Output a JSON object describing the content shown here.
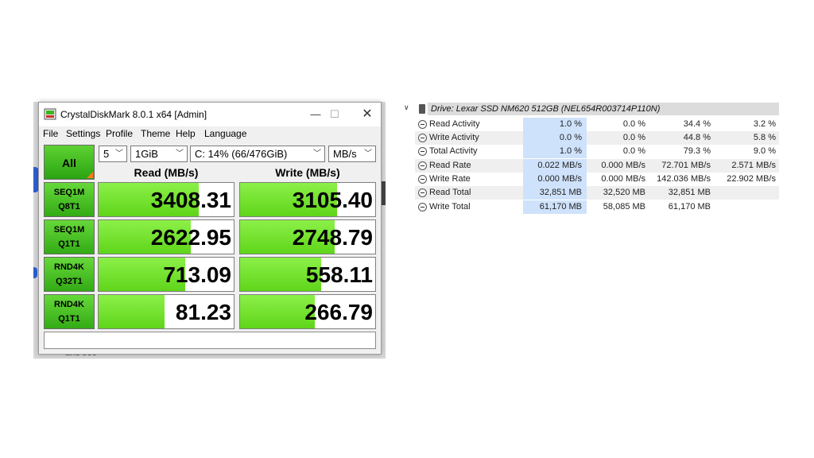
{
  "crystaldiskmark": {
    "title": "CrystalDiskMark 8.0.1 x64 [Admin]",
    "window_controls": {
      "minimize": "—",
      "maximize": "☐",
      "close": "✕"
    },
    "menu": [
      "File",
      "Settings",
      "Profile",
      "Theme",
      "Help",
      "Language"
    ],
    "all_button": "All",
    "test_count": "5",
    "test_size": "1GiB",
    "drive": "C: 14% (66/476GiB)",
    "unit": "MB/s",
    "read_header": "Read (MB/s)",
    "write_header": "Write (MB/s)",
    "tests": [
      {
        "line1": "SEQ1M",
        "line2": "Q8T1",
        "read": "3408.31",
        "write": "3105.40",
        "read_fill": 0.74,
        "write_fill": 0.72
      },
      {
        "line1": "SEQ1M",
        "line2": "Q1T1",
        "read": "2622.95",
        "write": "2748.79",
        "read_fill": 0.68,
        "write_fill": 0.7
      },
      {
        "line1": "RND4K",
        "line2": "Q32T1",
        "read": "713.09",
        "write": "558.11",
        "read_fill": 0.64,
        "write_fill": 0.6
      },
      {
        "line1": "RND4K",
        "line2": "Q1T1",
        "read": "81.23",
        "write": "266.79",
        "read_fill": 0.49,
        "write_fill": 0.55
      }
    ],
    "comment": "",
    "colors": {
      "accent_green": "#5fd51a",
      "corner_orange": "#ff7a1a"
    }
  },
  "background": {
    "fragment_text": "and 500"
  },
  "drive_panel": {
    "label": "Drive: Lexar SSD NM620 512GB (NEL654R003714P110N)",
    "rows": [
      {
        "name": "Read Activity",
        "values": [
          "1.0 %",
          "0.0 %",
          "34.4 %",
          "3.2 %"
        ]
      },
      {
        "name": "Write Activity",
        "values": [
          "0.0 %",
          "0.0 %",
          "44.8 %",
          "5.8 %"
        ]
      },
      {
        "name": "Total Activity",
        "values": [
          "1.0 %",
          "0.0 %",
          "79.3 %",
          "9.0 %"
        ]
      },
      {
        "name": "Read Rate",
        "values": [
          "0.022 MB/s",
          "0.000 MB/s",
          "72.701 MB/s",
          "2.571 MB/s"
        ]
      },
      {
        "name": "Write Rate",
        "values": [
          "0.000 MB/s",
          "0.000 MB/s",
          "142.036 MB/s",
          "22.902 MB/s"
        ]
      },
      {
        "name": "Read Total",
        "values": [
          "32,851 MB",
          "32,520 MB",
          "32,851 MB",
          ""
        ]
      },
      {
        "name": "Write Total",
        "values": [
          "61,170 MB",
          "58,085 MB",
          "61,170 MB",
          ""
        ]
      }
    ],
    "highlight_color": "#cfe2fb"
  }
}
